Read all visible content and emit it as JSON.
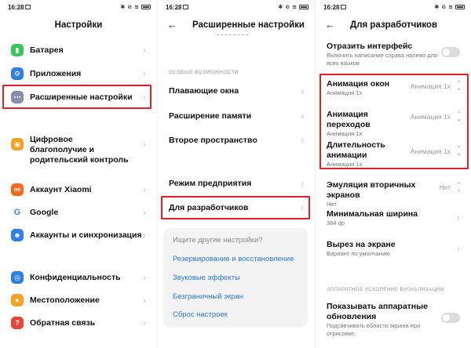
{
  "status": {
    "time": "16:28"
  },
  "panel1": {
    "title": "Настройки",
    "items": [
      {
        "label": "Батарея",
        "icon": "battery-icon",
        "color": "#3cc35a"
      },
      {
        "label": "Приложения",
        "icon": "gear-icon",
        "color": "#2f7fe6"
      },
      {
        "label": "Расширенные настройки",
        "icon": "more-dots-icon",
        "color": "#8a8fa8"
      },
      {
        "label": "Цифровое благополучие и родительский контроль",
        "icon": "wellbeing-icon",
        "color": "#f2a327"
      },
      {
        "label": "Аккаунт Xiaomi",
        "icon": "xiaomi-logo-icon",
        "color": "#f26a1b"
      },
      {
        "label": "Google",
        "icon": "google-logo-icon",
        "color": "#ffffff"
      },
      {
        "label": "Аккаунты и синхронизация",
        "icon": "user-sync-icon",
        "color": "#2f7fe6"
      },
      {
        "label": "Конфиденциальность",
        "icon": "privacy-eye-icon",
        "color": "#2f7fe6"
      },
      {
        "label": "Местоположение",
        "icon": "location-pin-icon",
        "color": "#f2a327"
      },
      {
        "label": "Обратная связь",
        "icon": "feedback-icon",
        "color": "#e8453c"
      }
    ]
  },
  "panel2": {
    "title": "Расширенные настройки",
    "section": "ОСОБЫЕ ВОЗМОЖНОСТИ",
    "items": [
      {
        "label": "Плавающие окна"
      },
      {
        "label": "Расширение памяти"
      },
      {
        "label": "Второе пространство"
      },
      {
        "label": "Режим предприятия"
      },
      {
        "label": "Для разработчиков"
      }
    ],
    "search": {
      "question": "Ищите другие настройки?",
      "links": [
        "Резервирование и восстановление",
        "Звуковые эффекты",
        "Безграничный экран",
        "Сброс настроек"
      ]
    }
  },
  "panel3": {
    "title": "Для разработчиков",
    "mirror": {
      "label": "Отразить интерфейс",
      "sub": "Включить написание справа налево для всех языков"
    },
    "anim": [
      {
        "label": "Анимация окон",
        "sub": "Анимация 1x",
        "value": "Анимация 1x"
      },
      {
        "label": "Анимация переходов",
        "sub": "Анимация 1x",
        "value": "Анимация 1x"
      },
      {
        "label": "Длительность анимации",
        "sub": "Анимация 1x",
        "value": "Анимация 1x"
      }
    ],
    "emulation": {
      "label": "Эмуляция вторичных экранов",
      "sub": "Нет",
      "value": "Нет"
    },
    "minwidth": {
      "label": "Минимальная ширина",
      "sub": "384 dp"
    },
    "cutout": {
      "label": "Вырез на экране",
      "sub": "Вариант по умолчанию"
    },
    "section": "АППАРАТНОЕ УСКОРЕНИЕ ВИЗУАЛИЗАЦИИ",
    "hwupdates": {
      "label": "Показывать аппаратные обновления",
      "sub": "Подсвечивать области экрана при отрисовке."
    }
  },
  "colors": {
    "highlight": "#e0202a",
    "link": "#2a78d8"
  }
}
